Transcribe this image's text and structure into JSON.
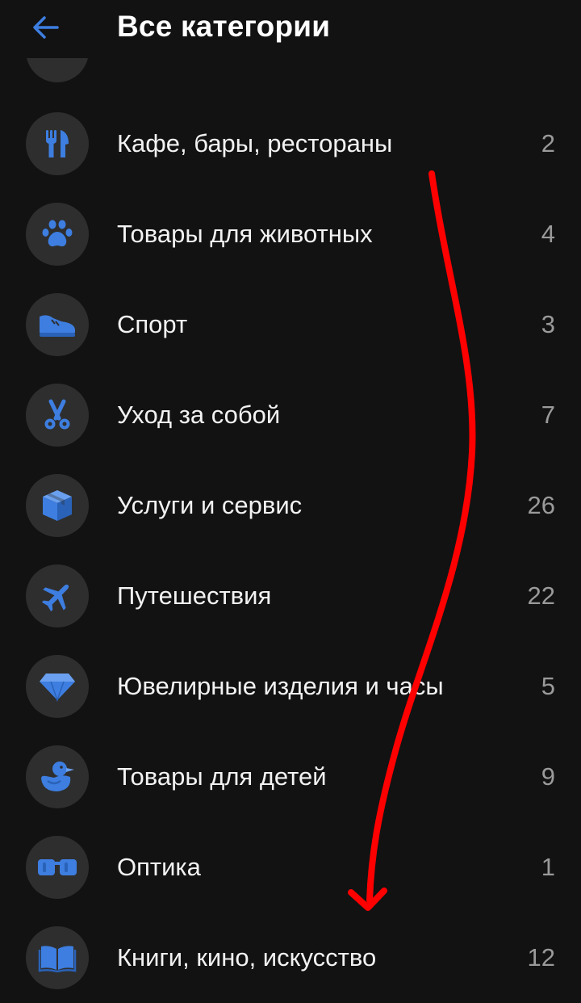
{
  "header": {
    "title": "Все категории"
  },
  "categories": [
    {
      "label": "Кафе, бары, рестораны",
      "count": "2",
      "icon": "fork-knife-icon"
    },
    {
      "label": "Товары для животных",
      "count": "4",
      "icon": "paw-icon"
    },
    {
      "label": "Спорт",
      "count": "3",
      "icon": "sneaker-icon"
    },
    {
      "label": "Уход за собой",
      "count": "7",
      "icon": "scissors-icon"
    },
    {
      "label": "Услуги и сервис",
      "count": "26",
      "icon": "box-icon"
    },
    {
      "label": "Путешествия",
      "count": "22",
      "icon": "airplane-icon"
    },
    {
      "label": "Ювелирные изделия и часы",
      "count": "5",
      "icon": "diamond-icon"
    },
    {
      "label": "Товары для детей",
      "count": "9",
      "icon": "duck-icon"
    },
    {
      "label": "Оптика",
      "count": "1",
      "icon": "glasses-icon"
    },
    {
      "label": "Книги, кино, искусство",
      "count": "12",
      "icon": "book-icon"
    }
  ],
  "colors": {
    "background": "#121212",
    "icon_circle": "#2e2e2e",
    "accent": "#3d7ee0",
    "annotation": "#ff0000"
  }
}
